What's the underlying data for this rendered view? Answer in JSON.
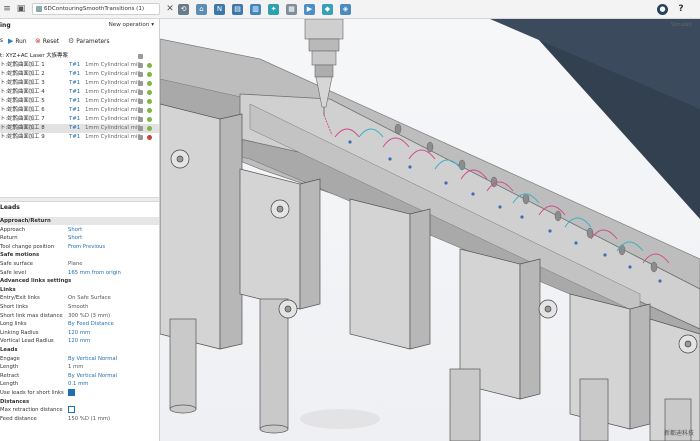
{
  "window": {
    "doc_title": "6DContouringSmoothTransitions (1)"
  },
  "operations": {
    "title": "ing",
    "new_operation": "New operation",
    "toolbar": [
      {
        "label": "s",
        "icon": "edit-icon"
      },
      {
        "label": "Run",
        "icon": "run-icon"
      },
      {
        "label": "Reset",
        "icon": "reset-icon"
      },
      {
        "label": "Parameters",
        "icon": "parameters-icon"
      }
    ],
    "root": "t: XYZ+AC Laser 大族專案",
    "items": [
      {
        "name": "ト:蛇鹘曲面加工 1",
        "tool": "T#1",
        "desc": "1mm Cylindrical mill",
        "status": "green"
      },
      {
        "name": "ト:蛇鹘曲面加工 2",
        "tool": "T#1",
        "desc": "1mm Cylindrical mill",
        "status": "green"
      },
      {
        "name": "ト:蛇鹘曲面加工 3",
        "tool": "T#1",
        "desc": "1mm Cylindrical mill",
        "status": "green"
      },
      {
        "name": "ト:蛇鹘曲面加工 4",
        "tool": "T#1",
        "desc": "1mm Cylindrical mill",
        "status": "green"
      },
      {
        "name": "ト:蛇鹘曲面加工 5",
        "tool": "T#1",
        "desc": "1mm Cylindrical mill",
        "status": "green"
      },
      {
        "name": "ト:蛇鹘曲面加工 6",
        "tool": "T#1",
        "desc": "1mm Cylindrical mill",
        "status": "green"
      },
      {
        "name": "ト:蛇鹘曲面加工 7",
        "tool": "T#1",
        "desc": "1mm Cylindrical mill",
        "status": "green"
      },
      {
        "name": "ト:蛇鹘曲面加工 8",
        "tool": "T#1",
        "desc": "1mm Cylindrical mill",
        "status": "green",
        "selected": true
      },
      {
        "name": "ト:蛇鹘曲面加工 9",
        "tool": "T#1",
        "desc": "1mm Cylindrical mill",
        "status": "red"
      }
    ]
  },
  "leads": {
    "title": "Leads",
    "rows": [
      {
        "type": "group",
        "key": "Approach/Return"
      },
      {
        "key": "Approach",
        "value": "Short"
      },
      {
        "key": "Return",
        "value": "Short"
      },
      {
        "key": "Tool change position",
        "value": "From Previous"
      },
      {
        "type": "group2",
        "key": "Safe motions"
      },
      {
        "key": "Safe surface",
        "value": "Plane",
        "gray": true
      },
      {
        "key": "Safe level",
        "value": "165 mm from origin"
      },
      {
        "type": "group2",
        "key": "Advanced links settings"
      },
      {
        "type": "group2",
        "key": "Links"
      },
      {
        "key": "Entry/Exit links",
        "value": "On Safe Surface",
        "gray": true
      },
      {
        "key": "Short links",
        "value": "Smooth",
        "gray": true
      },
      {
        "key": "Short link max distance",
        "value": "300 %D (3 mm)",
        "gray": true
      },
      {
        "key": "Long links",
        "value": "By Feed Distance"
      },
      {
        "key": "Linking Radius",
        "value": "120 mm"
      },
      {
        "key": "Vertical Lead Radius",
        "value": "120 mm"
      },
      {
        "type": "group2",
        "key": "Leads"
      },
      {
        "key": "Engage",
        "value": "By Vertical Normal"
      },
      {
        "key": "Length",
        "value": "1 mm",
        "gray": true
      },
      {
        "key": "Retract",
        "value": "By Vertical Normal"
      },
      {
        "key": "Length",
        "value": "0.1 mm"
      },
      {
        "key": "Use leads for short links",
        "value": "",
        "check": true
      },
      {
        "type": "group2",
        "key": "Distances"
      },
      {
        "key": "Max retraction distance",
        "value": "",
        "check": false
      },
      {
        "key": "Feed distance",
        "value": "150 %D (1 mm)",
        "gray": true
      }
    ]
  },
  "viewport": {
    "corner_label": "Simulati",
    "watermark": "新都迪科技"
  },
  "colors": {
    "accent": "#1f6fb3",
    "status_ok": "#7db743",
    "status_err": "#c94242",
    "toolpath_pink": "#d24a8a",
    "toolpath_cyan": "#3ab0c7"
  }
}
